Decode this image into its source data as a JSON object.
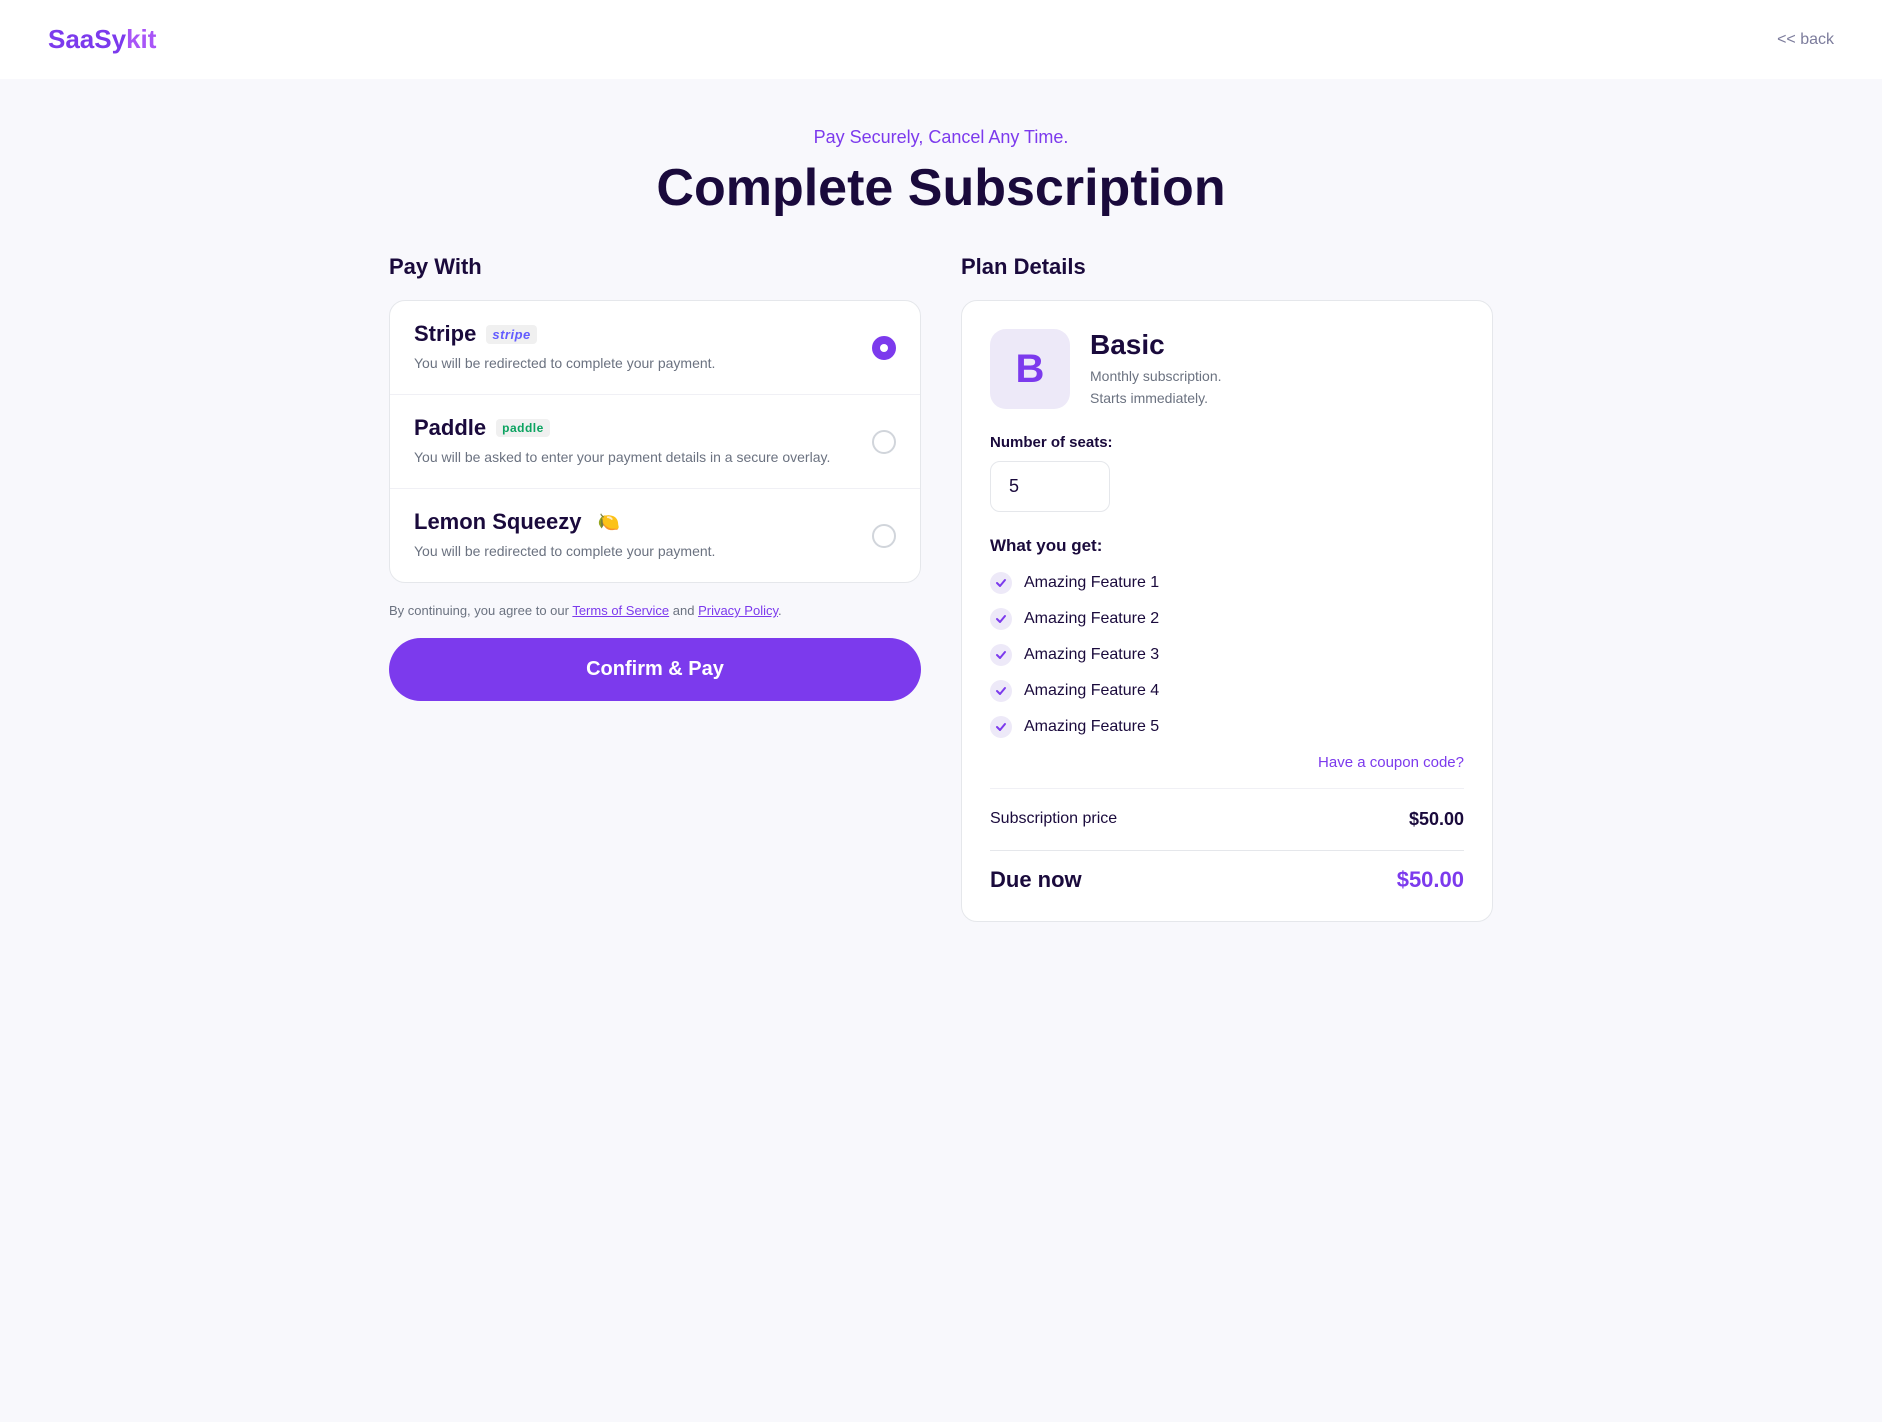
{
  "header": {
    "logo_prefix": "SaaSy",
    "logo_suffix": "kit",
    "back_label": "<< back"
  },
  "hero": {
    "subtitle": "Pay Securely, Cancel Any Time.",
    "title": "Complete Subscription"
  },
  "pay_with": {
    "section_title": "Pay With",
    "payment_options": [
      {
        "name": "Stripe",
        "badge": "stripe",
        "badge_type": "stripe-badge",
        "description": "You will be redirected to complete your payment.",
        "selected": true
      },
      {
        "name": "Paddle",
        "badge": "paddle",
        "badge_type": "paddle-badge",
        "description": "You will be asked to enter your payment details in a secure overlay.",
        "selected": false
      },
      {
        "name": "Lemon Squeezy",
        "badge": "🍋",
        "badge_type": "lemon-badge",
        "description": "You will be redirected to complete your payment.",
        "selected": false
      }
    ],
    "terms_text": "By continuing, you agree to our ",
    "terms_of_service": "Terms of Service",
    "and_text": " and ",
    "privacy_policy": "Privacy Policy",
    "period": ".",
    "confirm_button_label": "Confirm & Pay"
  },
  "plan_details": {
    "section_title": "Plan Details",
    "plan_icon": "B",
    "plan_name": "Basic",
    "plan_description_line1": "Monthly subscription.",
    "plan_description_line2": "Starts immediately.",
    "seats_label": "Number of seats:",
    "seats_value": "5",
    "features_title": "What you get:",
    "features": [
      "Amazing Feature 1",
      "Amazing Feature 2",
      "Amazing Feature 3",
      "Amazing Feature 4",
      "Amazing Feature 5"
    ],
    "coupon_label": "Have a coupon code?",
    "subscription_price_label": "Subscription price",
    "subscription_price_value": "$50.00",
    "due_label": "Due now",
    "due_value": "$50.00"
  }
}
